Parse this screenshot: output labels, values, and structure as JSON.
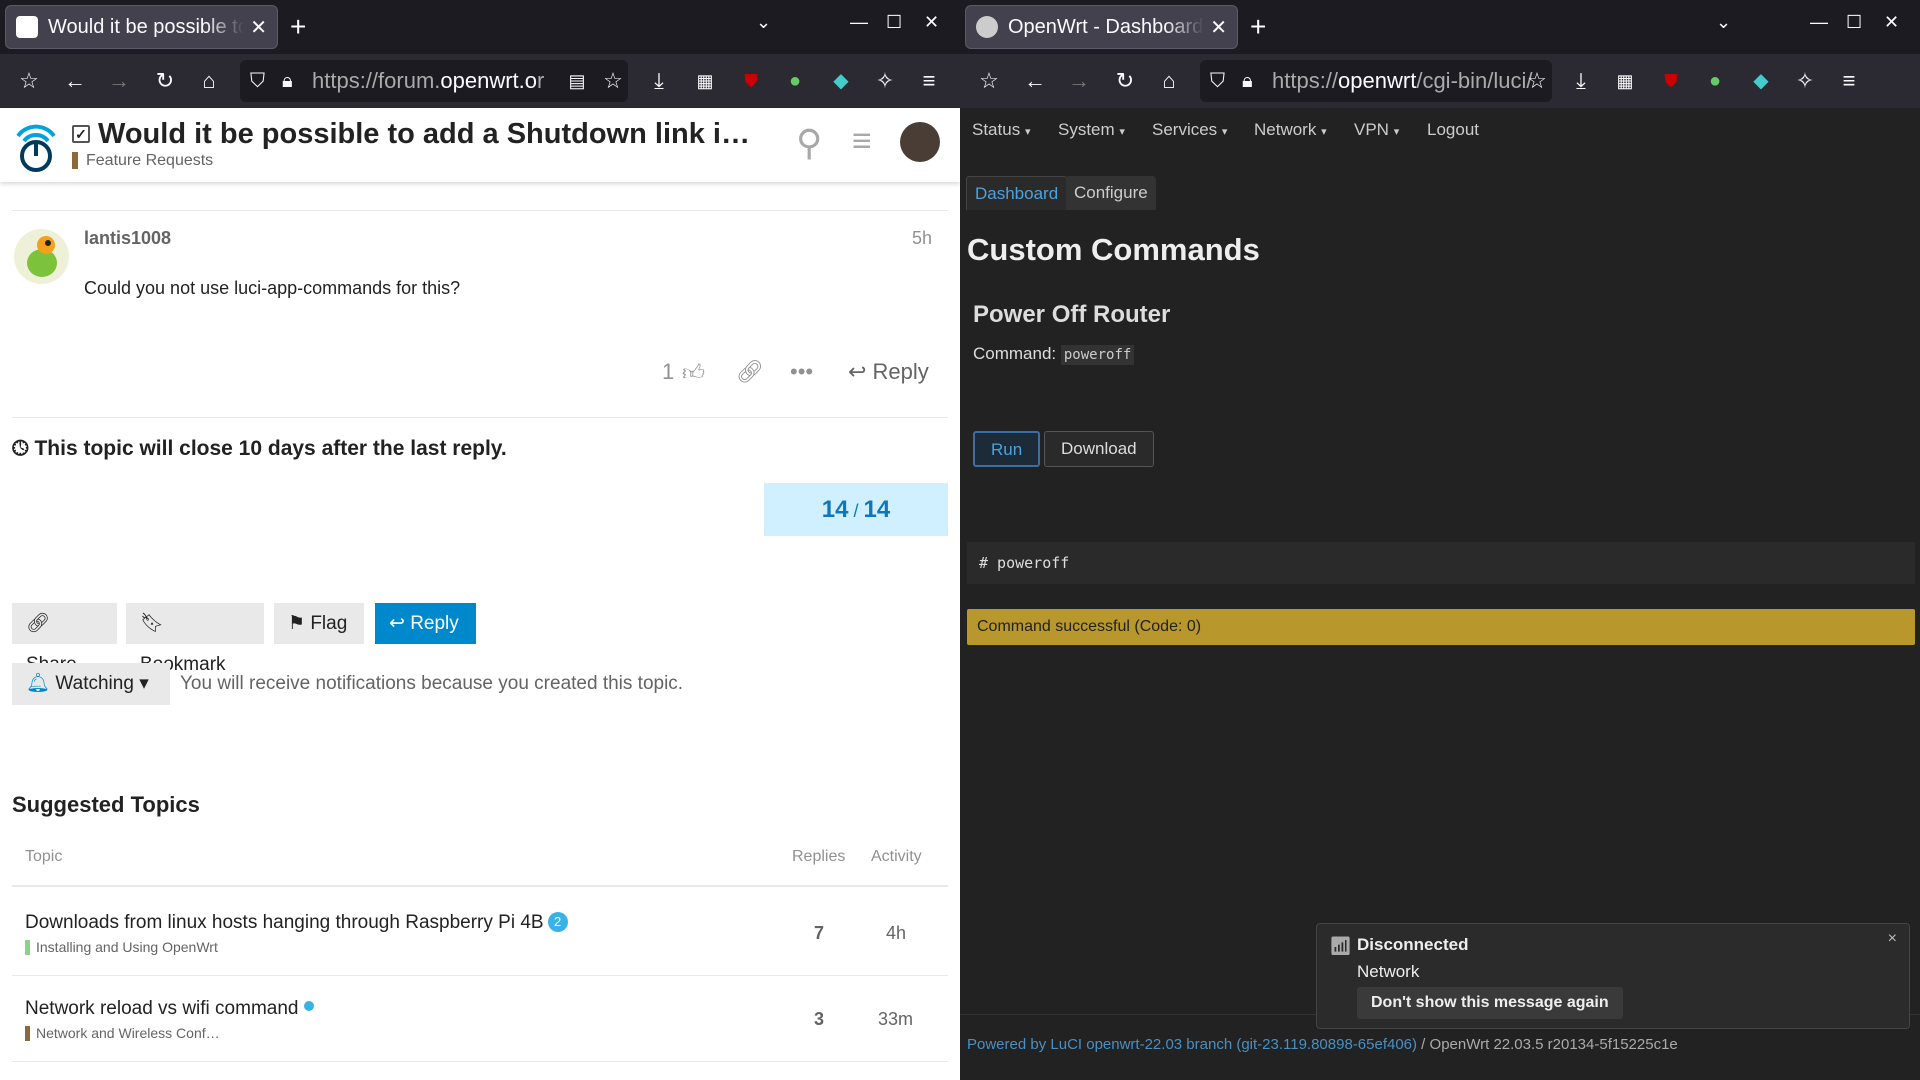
{
  "left": {
    "tab_title": "Would it be possible to add a Shutdown link in",
    "url": {
      "host": "https://forum.",
      "domain": "openwrt.o",
      "rest": "r"
    },
    "topic": {
      "title": "Would it be possible to add a Shutdown link i…",
      "category": "Feature Requests"
    },
    "post": {
      "username": "lantis1008",
      "time": "5h",
      "text": "Could you not use luci-app-commands for this?",
      "likes": "1",
      "reply_label": "Reply"
    },
    "close_notice": "This topic will close 10 days after the last reply.",
    "progress": {
      "current": "14",
      "sep": " / ",
      "total": "14"
    },
    "buttons": {
      "share": "Share",
      "bookmark": "Bookmark",
      "flag": "Flag",
      "reply": "Reply"
    },
    "watching": {
      "label": "Watching",
      "text": "You will receive notifications because you created this topic."
    },
    "suggested": {
      "heading": "Suggested Topics",
      "columns": {
        "topic": "Topic",
        "replies": "Replies",
        "activity": "Activity"
      },
      "rows": [
        {
          "title": "Downloads from linux hosts hanging through Raspberry Pi 4B",
          "badge": "2",
          "category": "Installing and Using OpenWrt",
          "category_color": "#8ad28a",
          "replies": "7",
          "activity": "4h"
        },
        {
          "title": "Network reload vs wifi command",
          "category": "Network and Wireless Conf…",
          "category_color": "#8a6a3a",
          "replies": "3",
          "activity": "33m"
        }
      ]
    }
  },
  "right": {
    "tab_title": "OpenWrt - Dashboard - LuCI",
    "url": {
      "host": "https://",
      "domain": "openwrt",
      "rest": "/cgi-bin/luci/"
    },
    "menu": [
      "Status",
      "System",
      "Services",
      "Network",
      "VPN",
      "Logout"
    ],
    "tabs": {
      "dashboard": "Dashboard",
      "configure": "Configure"
    },
    "heading": "Custom Commands",
    "command_title": "Power Off Router",
    "command_label": "Command:",
    "command_value": "poweroff",
    "run_label": "Run",
    "download_label": "Download",
    "output": "# poweroff",
    "status": "Command successful (Code: 0)",
    "footer": {
      "powered": "Powered by LuCI openwrt-22.03 branch (git-23.119.80898-65ef406)",
      "sep": " / ",
      "version": "OpenWrt 22.03.5 r20134-5f15225c1e"
    },
    "notification": {
      "title": "Disconnected",
      "body": "Network",
      "action": "Don't show this message again",
      "close": "×"
    }
  }
}
